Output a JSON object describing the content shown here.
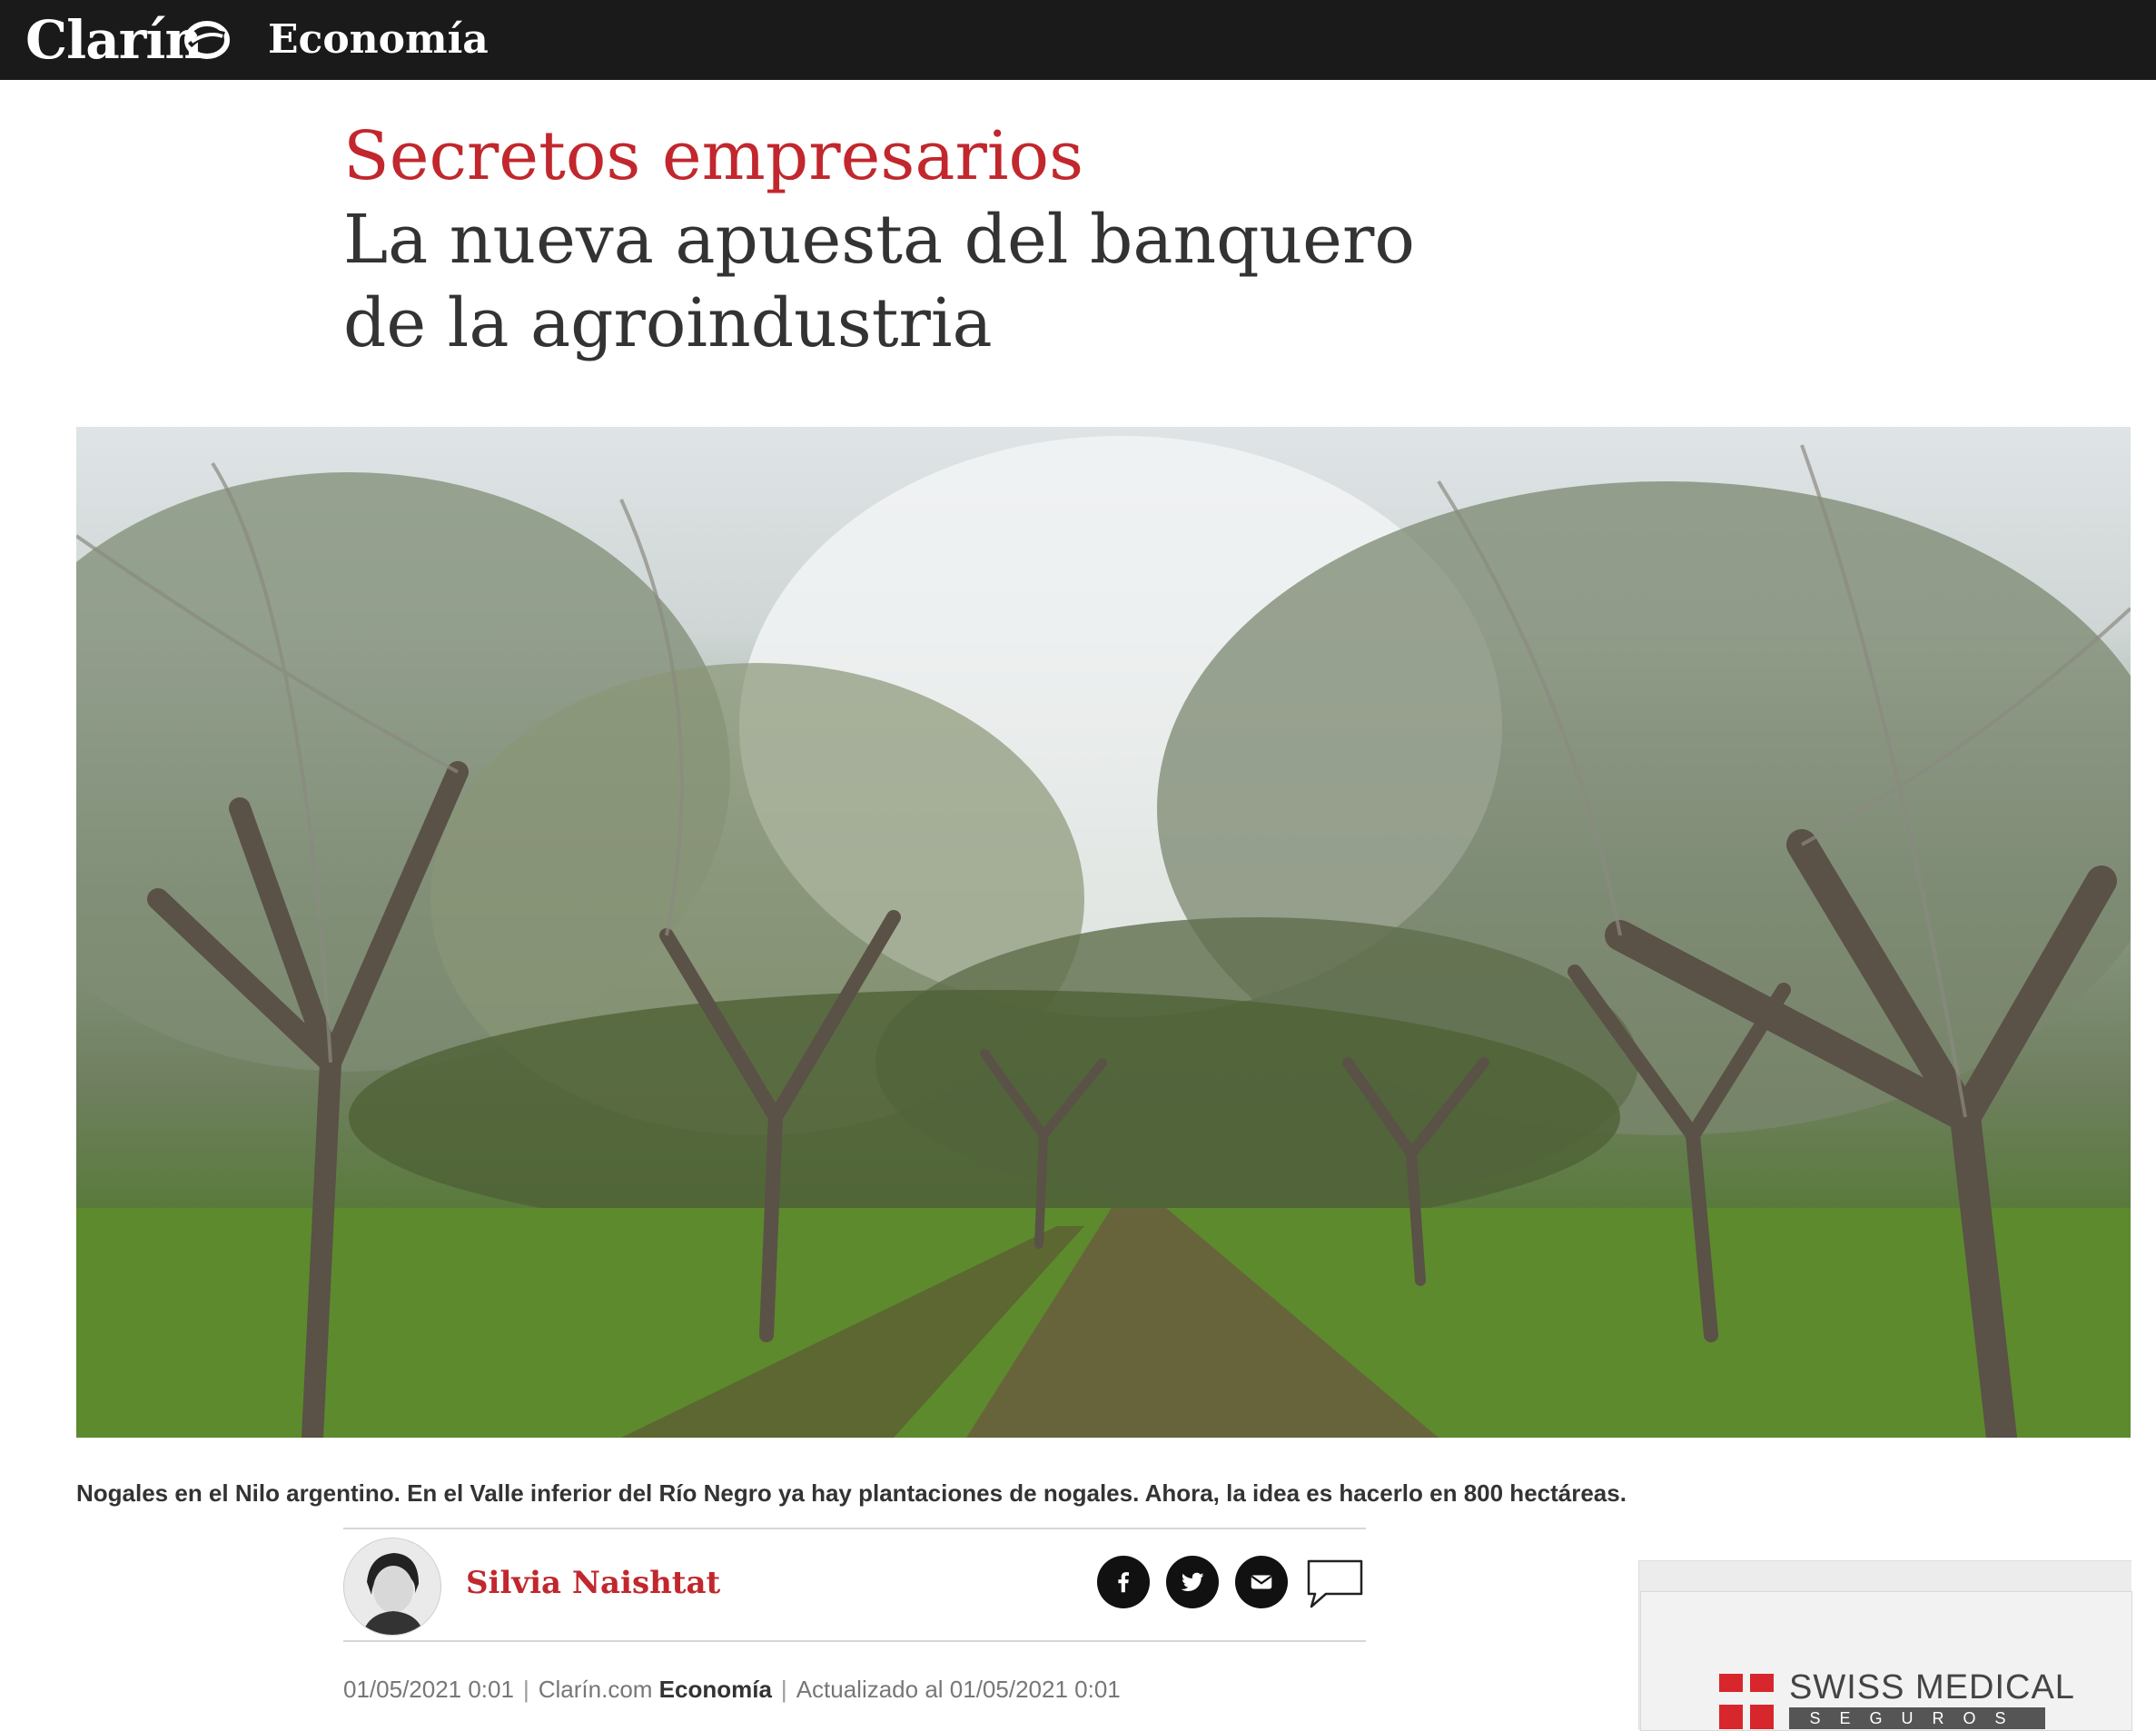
{
  "header": {
    "logo": "Clarín",
    "section": "Economía"
  },
  "article": {
    "kicker": "Secretos empresarios",
    "headline": "La nueva apuesta del banquero de la agroindustria",
    "caption": "Nogales en el Nilo argentino. En el Valle inferior del Río Negro ya hay plantaciones de nogales. Ahora, la idea es hacerlo en 800 hectáreas.",
    "author": "Silvia Naishtat",
    "published": "01/05/2021 0:01",
    "source": "Clarín.com",
    "section": "Economía",
    "updated": "Actualizado al 01/05/2021 0:01"
  },
  "share": {
    "icons": [
      "facebook-icon",
      "twitter-icon",
      "email-icon",
      "comment-icon"
    ]
  },
  "ad": {
    "brand": "SWISS MEDICAL",
    "sub": "SEGUROS"
  },
  "colors": {
    "accent": "#c1272d",
    "topbar": "#1a1a1a"
  }
}
